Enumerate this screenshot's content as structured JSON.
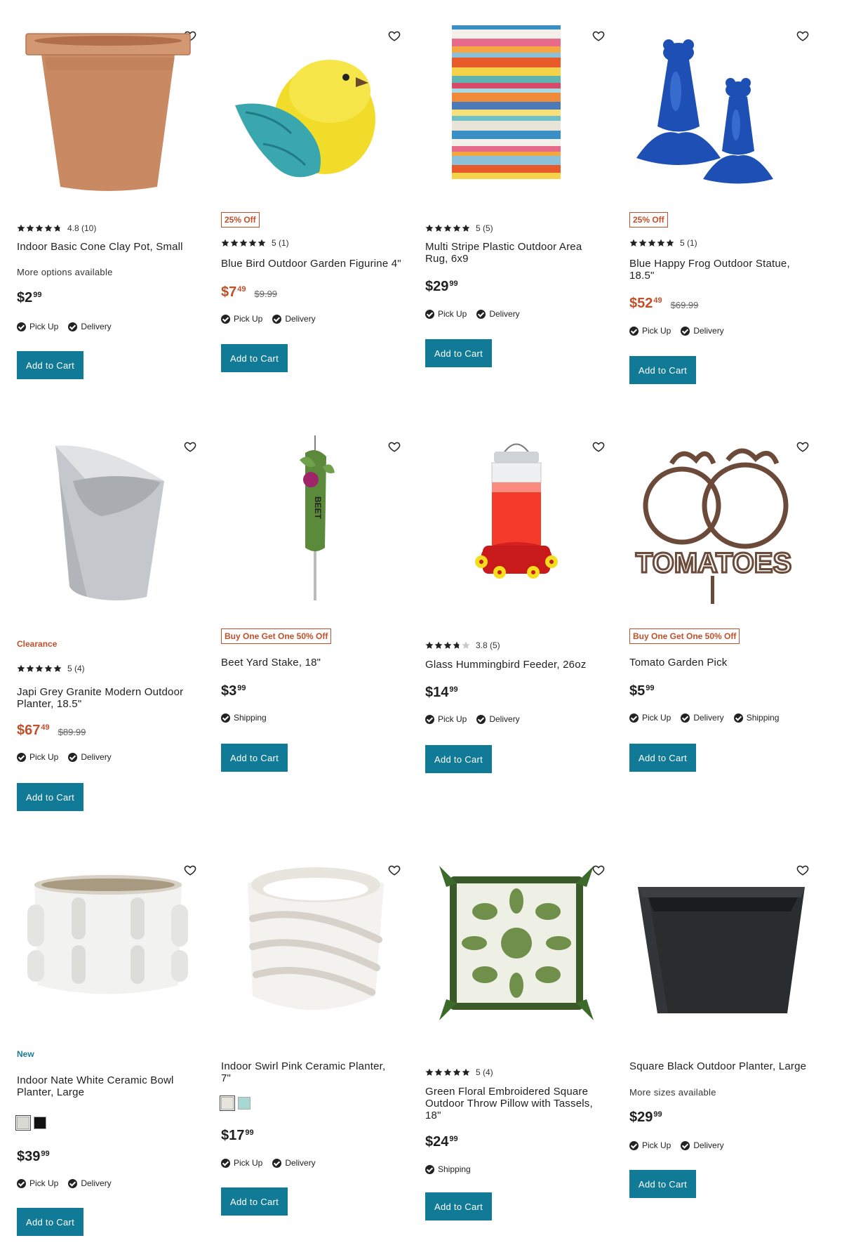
{
  "colors": {
    "accent": "#117a96",
    "sale": "#c0502a",
    "new": "#1b7c9a"
  },
  "icons": {
    "wishlist": "heart-outline-icon",
    "check": "check-circle-icon",
    "star": "star-icon"
  },
  "products": [
    {
      "id": "p1",
      "rating": "4.8 (10)",
      "stars": 4.8,
      "title": "Indoor Basic Cone Clay Pot, Small",
      "sub": "More options available",
      "price": "$2",
      "cents": "99",
      "fulfillment": [
        "Pick Up",
        "Delivery"
      ],
      "button": "Add to Cart"
    },
    {
      "id": "p2",
      "badge": "25% Off",
      "rating": "5 (1)",
      "stars": 5,
      "title": "Blue Bird Outdoor Garden Figurine 4\"",
      "price": "$7",
      "cents": "49",
      "was": "$9.99",
      "fulfillment": [
        "Pick Up",
        "Delivery"
      ],
      "button": "Add to Cart"
    },
    {
      "id": "p3",
      "rating": "5 (5)",
      "stars": 5,
      "title": "Multi Stripe Plastic Outdoor Area Rug, 6x9",
      "price": "$29",
      "cents": "99",
      "fulfillment": [
        "Pick Up",
        "Delivery"
      ],
      "button": "Add to Cart"
    },
    {
      "id": "p4",
      "badge": "25% Off",
      "rating": "5 (1)",
      "stars": 5,
      "title": "Blue Happy Frog Outdoor Statue, 18.5\"",
      "price": "$52",
      "cents": "49",
      "was": "$69.99",
      "fulfillment": [
        "Pick Up",
        "Delivery"
      ],
      "button": "Add to Cart"
    },
    {
      "id": "p5",
      "label": "Clearance",
      "rating": "5 (4)",
      "stars": 5,
      "title": "Japi Grey Granite Modern Outdoor Planter, 18.5\"",
      "price": "$67",
      "cents": "49",
      "was": "$89.99",
      "fulfillment": [
        "Pick Up",
        "Delivery"
      ],
      "button": "Add to Cart"
    },
    {
      "id": "p6",
      "badge": "Buy One Get One 50% Off",
      "title": "Beet Yard Stake, 18\"",
      "price": "$3",
      "cents": "99",
      "fulfillment": [
        "Shipping"
      ],
      "button": "Add to Cart",
      "image_text": "BEET"
    },
    {
      "id": "p7",
      "rating": "3.8 (5)",
      "stars": 3.8,
      "title": "Glass Hummingbird Feeder, 26oz",
      "price": "$14",
      "cents": "99",
      "fulfillment": [
        "Pick Up",
        "Delivery"
      ],
      "button": "Add to Cart"
    },
    {
      "id": "p8",
      "badge": "Buy One Get One 50% Off",
      "title": "Tomato Garden Pick",
      "price": "$5",
      "cents": "99",
      "fulfillment": [
        "Pick Up",
        "Delivery",
        "Shipping"
      ],
      "button": "Add to Cart",
      "image_text": "TOMATOES"
    },
    {
      "id": "p9",
      "label": "New",
      "title": "Indoor Nate White Ceramic Bowl Planter, Large",
      "swatches": [
        "#d9d9d6",
        "#111111"
      ],
      "price": "$39",
      "cents": "99",
      "fulfillment": [
        "Pick Up",
        "Delivery"
      ],
      "button": "Add to Cart"
    },
    {
      "id": "p10",
      "title": "Indoor Swirl Pink Ceramic Planter, 7\"",
      "swatches": [
        "#e9e4dc",
        "#a8d8d2"
      ],
      "price": "$17",
      "cents": "99",
      "fulfillment": [
        "Pick Up",
        "Delivery"
      ],
      "button": "Add to Cart"
    },
    {
      "id": "p11",
      "rating": "5 (4)",
      "stars": 5,
      "title": "Green Floral Embroidered Square Outdoor Throw Pillow with Tassels, 18\"",
      "price": "$24",
      "cents": "99",
      "fulfillment": [
        "Shipping"
      ],
      "button": "Add to Cart"
    },
    {
      "id": "p12",
      "title": "Square Black Outdoor Planter, Large",
      "sub": "More sizes available",
      "price": "$29",
      "cents": "99",
      "fulfillment": [
        "Pick Up",
        "Delivery"
      ],
      "button": "Add to Cart"
    }
  ]
}
